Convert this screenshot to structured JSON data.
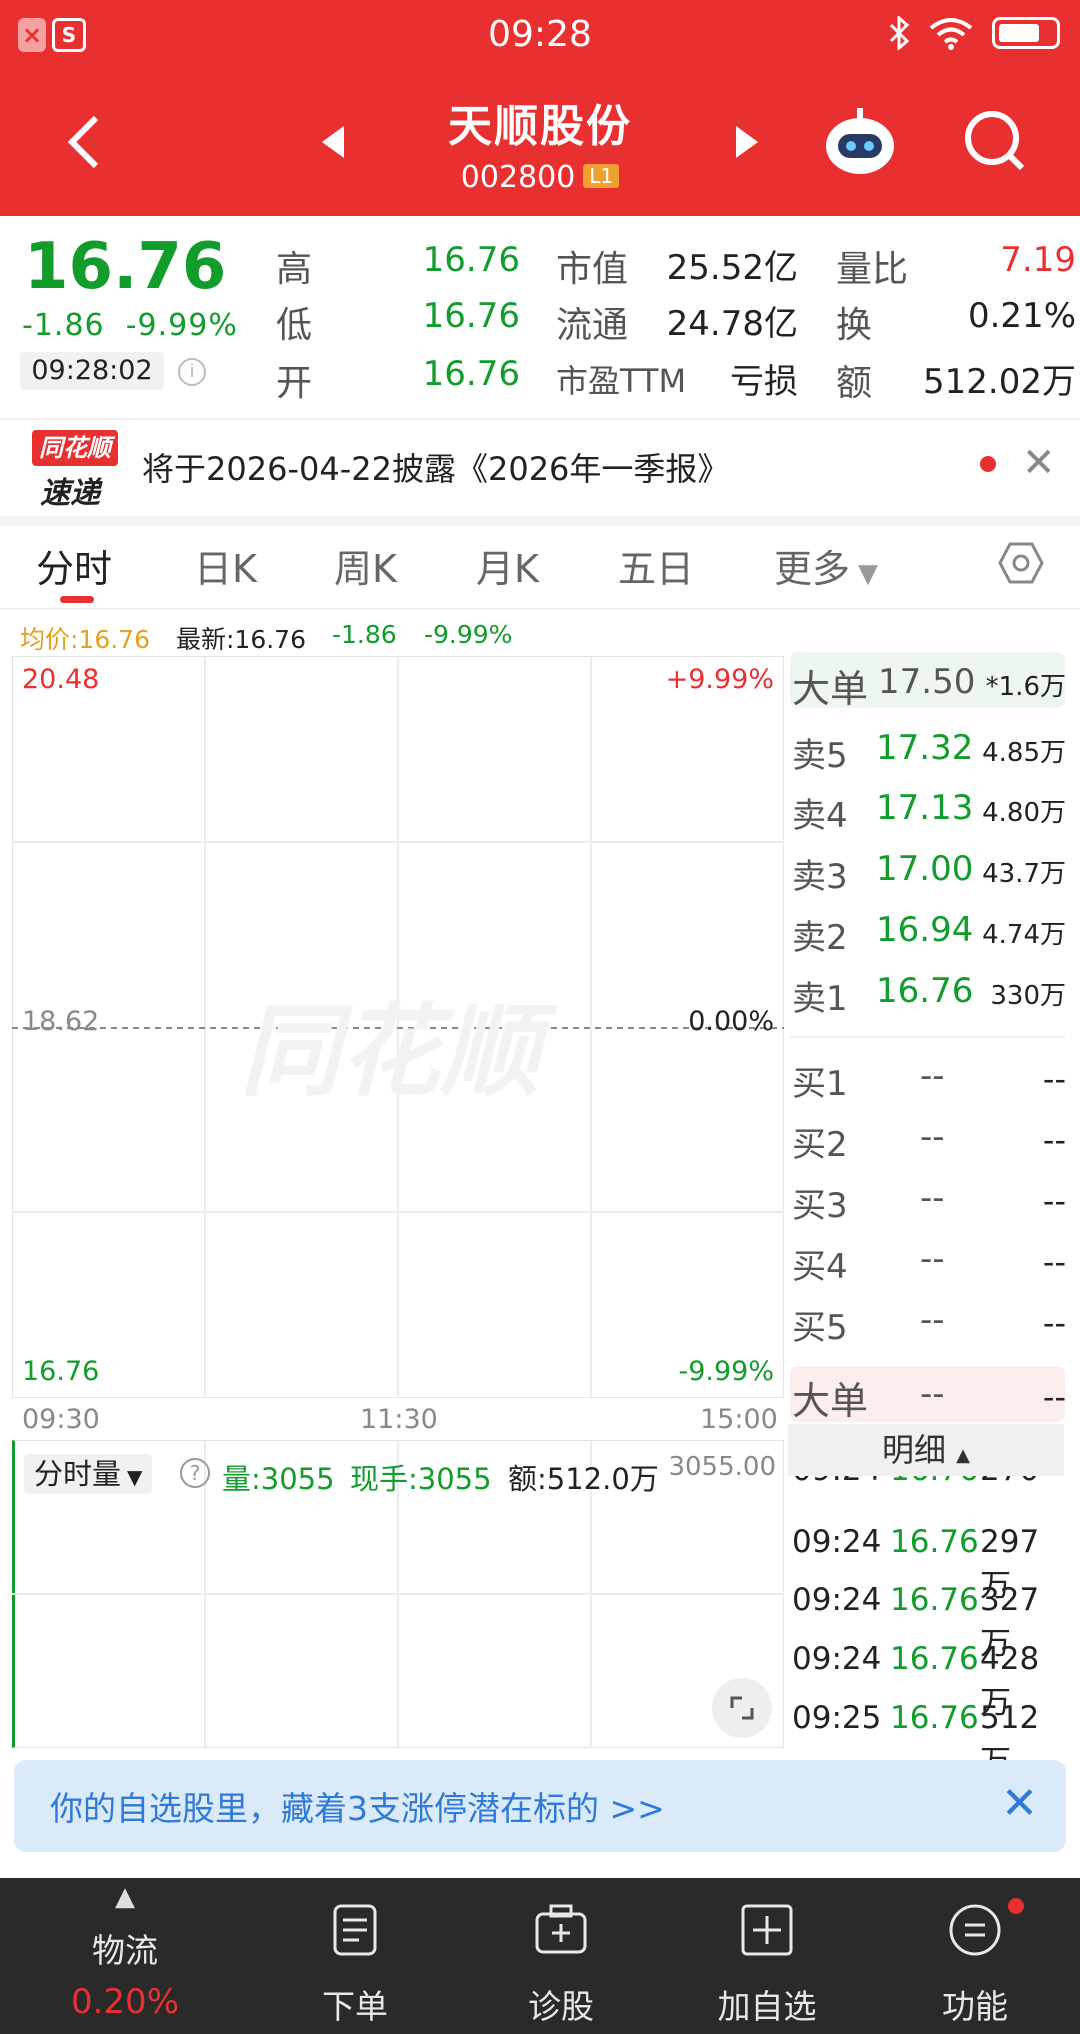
{
  "status_bar": {
    "time": "09:28"
  },
  "header": {
    "title": "天顺股份",
    "code": "002800",
    "level": "L1"
  },
  "quote": {
    "price": "16.76",
    "change": "-1.86",
    "change_pct": "-9.99%",
    "time": "09:28:02",
    "high_label": "高",
    "high": "16.76",
    "low_label": "低",
    "low": "16.76",
    "open_label": "开",
    "open": "16.76",
    "mcap_label": "市值",
    "mcap": "25.52亿",
    "float_label": "流通",
    "float": "24.78亿",
    "pe_label": "市盈TTM",
    "pe": "亏损",
    "vr_label": "量比",
    "vr": "7.19",
    "turnover_label": "换",
    "turnover": "0.21%",
    "amount_label": "额",
    "amount": "512.02万"
  },
  "news": {
    "logo_top": "同花顺",
    "logo_bottom": "速递",
    "text": "将于2026-04-22披露《2026年一季报》"
  },
  "tabs": [
    "分时",
    "日K",
    "周K",
    "月K",
    "五日",
    "更多"
  ],
  "stats": {
    "avg": "均价:16.76",
    "latest": "最新:16.76",
    "chg": "-1.86",
    "pct": "-9.99%"
  },
  "chart": {
    "y_top": "20.48",
    "y_mid": "18.62",
    "y_bot": "16.76",
    "pct_top": "+9.99%",
    "pct_mid": "0.00%",
    "pct_bot": "-9.99%",
    "x_labels": [
      "09:30",
      "11:30",
      "15:00"
    ],
    "watermark": "同花顺"
  },
  "volume": {
    "selector": "分时量",
    "vol": "量:3055",
    "now": "现手:3055",
    "amount": "额:512.0万",
    "max": "3055.00"
  },
  "orderbook": {
    "big_sell": {
      "label": "大单",
      "price": "17.50",
      "vol": "*1.6万"
    },
    "sells": [
      {
        "label": "卖5",
        "price": "17.32",
        "vol": "4.85万"
      },
      {
        "label": "卖4",
        "price": "17.13",
        "vol": "4.80万"
      },
      {
        "label": "卖3",
        "price": "17.00",
        "vol": "43.7万"
      },
      {
        "label": "卖2",
        "price": "16.94",
        "vol": "4.74万"
      },
      {
        "label": "卖1",
        "price": "16.76",
        "vol": "330万"
      }
    ],
    "buys": [
      {
        "label": "买1",
        "price": "--",
        "vol": "--"
      },
      {
        "label": "买2",
        "price": "--",
        "vol": "--"
      },
      {
        "label": "买3",
        "price": "--",
        "vol": "--"
      },
      {
        "label": "买4",
        "price": "--",
        "vol": "--"
      },
      {
        "label": "买5",
        "price": "--",
        "vol": "--"
      }
    ],
    "big_buy": {
      "label": "大单",
      "price": "--",
      "vol": "--"
    },
    "detail_label": "明细"
  },
  "ticks": [
    {
      "time": "09:24",
      "price": "16.76",
      "vol": "270万"
    },
    {
      "time": "09:24",
      "price": "16.76",
      "vol": "297万"
    },
    {
      "time": "09:24",
      "price": "16.76",
      "vol": "327万"
    },
    {
      "time": "09:24",
      "price": "16.76",
      "vol": "428万"
    },
    {
      "time": "09:25",
      "price": "16.76",
      "vol": "512万"
    }
  ],
  "banner": {
    "text": "你的自选股里，藏着3支涨停潜在标的 >>"
  },
  "bottom_nav": [
    {
      "label": "物流",
      "sub": "0.20%"
    },
    {
      "label": "下单"
    },
    {
      "label": "诊股"
    },
    {
      "label": "加自选"
    },
    {
      "label": "功能"
    }
  ],
  "colors": {
    "brand": "#e93030",
    "down": "#119c2c",
    "banner": "#2f7ad8"
  }
}
